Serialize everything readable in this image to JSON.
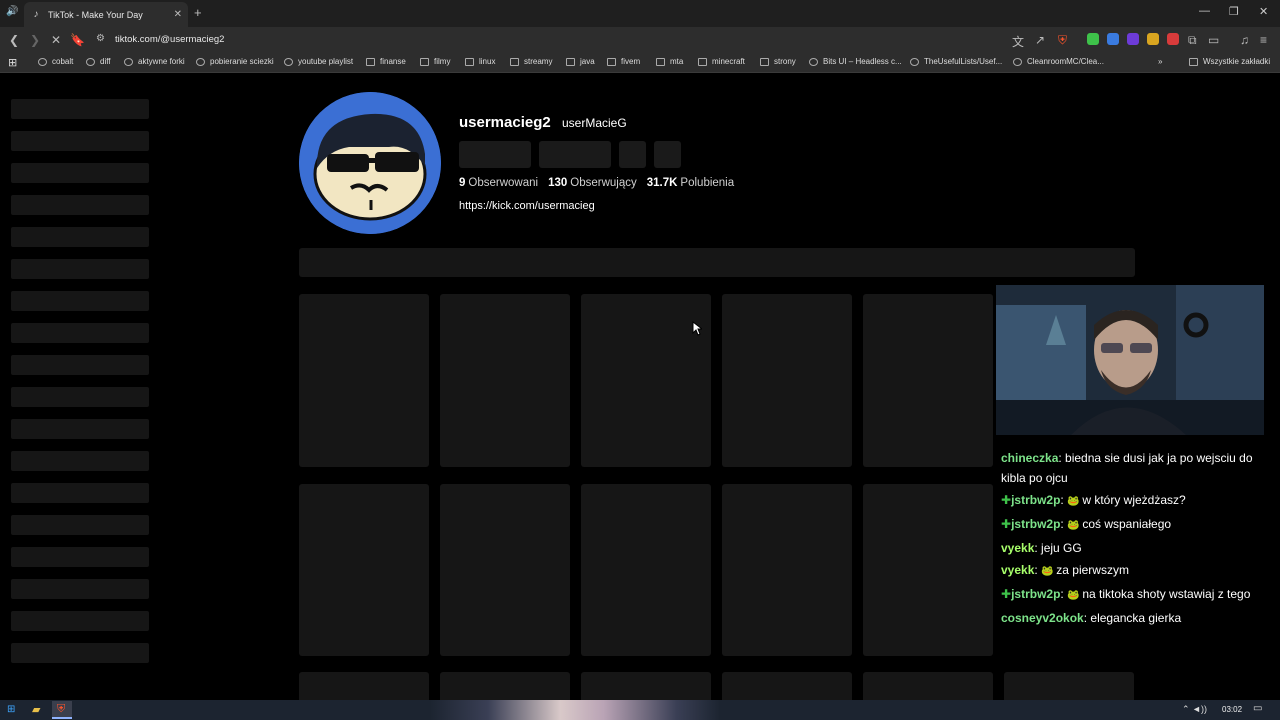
{
  "browser": {
    "tab_title": "TikTok - Make Your Day",
    "url": "tiktok.com/@usermacieg2",
    "bookmarks": [
      "cobalt",
      "diff",
      "aktywne forki",
      "pobieranie sciezki",
      "youtube playlist",
      "finanse",
      "filmy",
      "linux",
      "streamy",
      "java",
      "fivem",
      "mta",
      "minecraft",
      "strony",
      "Bits UI – Headless c...",
      "TheUsefulLists/Usef...",
      "CleanroomMC/Clea..."
    ],
    "all_bookmarks": "Wszystkie zakładki"
  },
  "profile": {
    "username": "usermacieg2",
    "nickname": "userMacieG",
    "following_count": "9",
    "following_label": "Obserwowani",
    "followers_count": "130",
    "followers_label": "Obserwujący",
    "likes_count": "31.7K",
    "likes_label": "Polubienia",
    "bio_link": "https://kick.com/usermacieg"
  },
  "chat": [
    {
      "user": "chineczka",
      "color": "#7de38a",
      "badge": false,
      "emote": false,
      "text": "biedna sie dusi jak ja po wejsciu do kibla po ojcu"
    },
    {
      "user": "jstrbw2p",
      "color": "#7de38a",
      "badge": true,
      "emote": true,
      "text": "w który wjeżdżasz?"
    },
    {
      "user": "jstrbw2p",
      "color": "#7de38a",
      "badge": true,
      "emote": true,
      "text": "coś wspaniałego"
    },
    {
      "user": "vyekk",
      "color": "#a8ff6b",
      "badge": false,
      "emote": false,
      "text": "jeju GG"
    },
    {
      "user": "vyekk",
      "color": "#a8ff6b",
      "badge": false,
      "emote": true,
      "text": "za pierwszym"
    },
    {
      "user": "jstrbw2p",
      "color": "#7de38a",
      "badge": true,
      "emote": true,
      "text": "na tiktoka shoty wstawiaj z tego"
    },
    {
      "user": "cosneyv2okok",
      "color": "#7de38a",
      "badge": false,
      "emote": false,
      "text": "elegancka gierka"
    }
  ],
  "taskbar": {
    "time": "03:02"
  },
  "icons": [
    "speaker-icon",
    "tiktok-favicon",
    "close-icon",
    "plus-icon",
    "minimize-icon",
    "restore-icon",
    "back-icon",
    "forward-icon",
    "stop-icon",
    "bookmark-icon",
    "site-info-icon",
    "translate-icon",
    "share-icon",
    "brave-shield-icon",
    "extensions-icon",
    "windows-start-icon",
    "file-explorer-icon",
    "brave-icon"
  ]
}
